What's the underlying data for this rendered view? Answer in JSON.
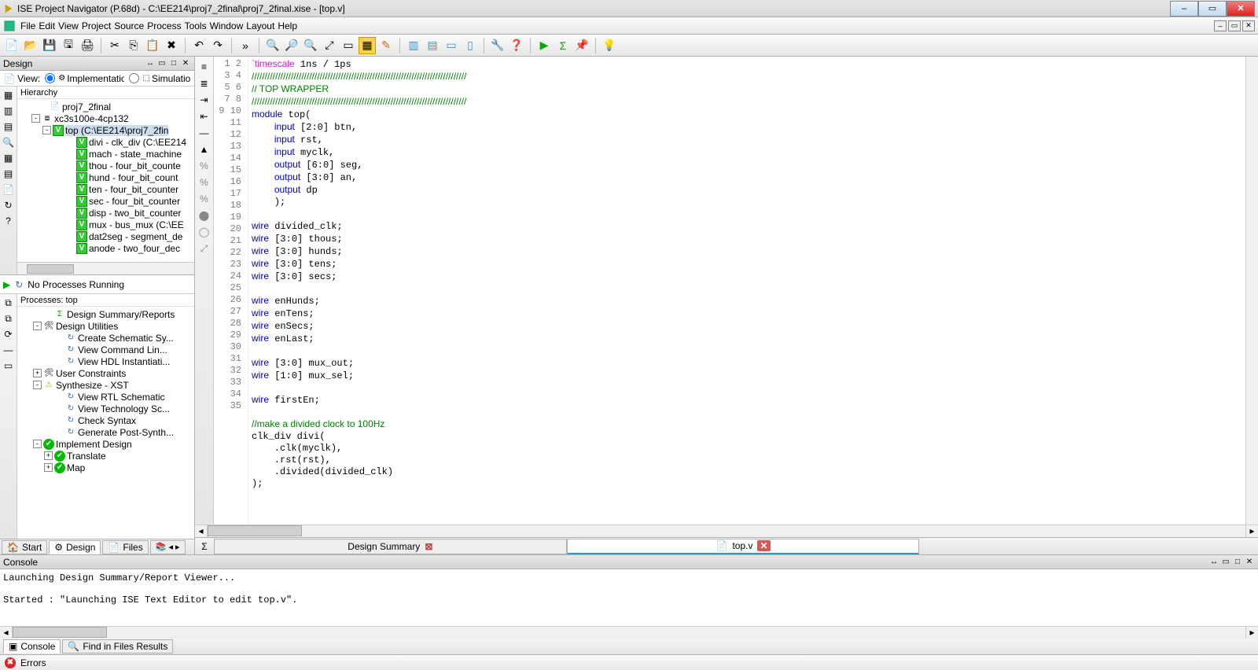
{
  "title": "ISE Project Navigator (P.68d) - C:\\EE214\\proj7_2final\\proj7_2final.xise - [top.v]",
  "menubar": [
    "File",
    "Edit",
    "View",
    "Project",
    "Source",
    "Process",
    "Tools",
    "Window",
    "Layout",
    "Help"
  ],
  "design_panel_title": "Design",
  "view_label": "View:",
  "view_impl": "Implementation",
  "view_sim": "Simulation",
  "hierarchy_title": "Hierarchy",
  "hierarchy": [
    {
      "indent": 28,
      "exp": "",
      "icon": "📄",
      "label": "proj7_2final"
    },
    {
      "indent": 18,
      "exp": "-",
      "icon": "⧈",
      "label": "xc3s100e-4cp132"
    },
    {
      "indent": 32,
      "exp": "-",
      "icon": "V",
      "label": "top (C:\\EE214\\proj7_2fin",
      "sel": true
    },
    {
      "indent": 62,
      "exp": "",
      "icon": "V",
      "label": "divi - clk_div (C:\\EE214"
    },
    {
      "indent": 62,
      "exp": "",
      "icon": "V",
      "label": "mach - state_machine"
    },
    {
      "indent": 62,
      "exp": "",
      "icon": "V",
      "label": "thou - four_bit_counte"
    },
    {
      "indent": 62,
      "exp": "",
      "icon": "V",
      "label": "hund - four_bit_count"
    },
    {
      "indent": 62,
      "exp": "",
      "icon": "V",
      "label": "ten - four_bit_counter"
    },
    {
      "indent": 62,
      "exp": "",
      "icon": "V",
      "label": "sec - four_bit_counter"
    },
    {
      "indent": 62,
      "exp": "",
      "icon": "V",
      "label": "disp - two_bit_counter"
    },
    {
      "indent": 62,
      "exp": "",
      "icon": "V",
      "label": "mux - bus_mux (C:\\EE"
    },
    {
      "indent": 62,
      "exp": "",
      "icon": "V",
      "label": "dat2seg - segment_de"
    },
    {
      "indent": 62,
      "exp": "",
      "icon": "V",
      "label": "anode - two_four_dec"
    }
  ],
  "no_processes": "No Processes Running",
  "processes_title": "Processes: top",
  "processes": [
    {
      "indent": 34,
      "exp": "",
      "icon": "Σ",
      "label": "Design Summary/Reports"
    },
    {
      "indent": 20,
      "exp": "-",
      "icon": "🛠",
      "label": "Design Utilities"
    },
    {
      "indent": 48,
      "exp": "",
      "icon": "↻",
      "label": "Create Schematic Sy..."
    },
    {
      "indent": 48,
      "exp": "",
      "icon": "↻",
      "label": "View Command Lin..."
    },
    {
      "indent": 48,
      "exp": "",
      "icon": "↻",
      "label": "View HDL Instantiati..."
    },
    {
      "indent": 20,
      "exp": "+",
      "icon": "🛠",
      "label": "User Constraints"
    },
    {
      "indent": 20,
      "exp": "-",
      "icon": "⚠",
      "label": "Synthesize - XST"
    },
    {
      "indent": 48,
      "exp": "",
      "icon": "↻",
      "label": "View RTL Schematic"
    },
    {
      "indent": 48,
      "exp": "",
      "icon": "↻",
      "label": "View Technology Sc..."
    },
    {
      "indent": 48,
      "exp": "",
      "icon": "↻",
      "label": "Check Syntax"
    },
    {
      "indent": 48,
      "exp": "",
      "icon": "↻",
      "label": "Generate Post-Synth..."
    },
    {
      "indent": 20,
      "exp": "-",
      "icon": "✔",
      "label": "Implement Design"
    },
    {
      "indent": 34,
      "exp": "+",
      "icon": "✔",
      "label": "Translate"
    },
    {
      "indent": 34,
      "exp": "+",
      "icon": "✔",
      "label": "Map"
    }
  ],
  "bottom_tabs": {
    "start": "Start",
    "design": "Design",
    "files": "Files"
  },
  "code_lines": [
    {
      "n": 1,
      "html": "<span class='mag'>`timescale</span> 1ns / 1ps"
    },
    {
      "n": 2,
      "html": "<span class='cm'>//////////////////////////////////////////////////////////////////////////////////</span>"
    },
    {
      "n": 3,
      "html": "<span class='cm'>// TOP WRAPPER</span>"
    },
    {
      "n": 4,
      "html": "<span class='cm'>//////////////////////////////////////////////////////////////////////////////////</span>"
    },
    {
      "n": 5,
      "html": "<span class='kw'>module</span> top("
    },
    {
      "n": 6,
      "html": "    <span class='kw'>input</span> [2:0] btn,"
    },
    {
      "n": 7,
      "html": "    <span class='kw'>input</span> rst,"
    },
    {
      "n": 8,
      "html": "    <span class='kw'>input</span> myclk,"
    },
    {
      "n": 9,
      "html": "    <span class='kw'>output</span> [6:0] seg,"
    },
    {
      "n": 10,
      "html": "    <span class='kw'>output</span> [3:0] an,"
    },
    {
      "n": 11,
      "html": "    <span class='kw'>output</span> dp"
    },
    {
      "n": 12,
      "html": "    );"
    },
    {
      "n": 13,
      "html": ""
    },
    {
      "n": 14,
      "html": "<span class='kw'>wire</span> divided_clk;"
    },
    {
      "n": 15,
      "html": "<span class='kw'>wire</span> [3:0] thous;"
    },
    {
      "n": 16,
      "html": "<span class='kw'>wire</span> [3:0] hunds;"
    },
    {
      "n": 17,
      "html": "<span class='kw'>wire</span> [3:0] tens;"
    },
    {
      "n": 18,
      "html": "<span class='kw'>wire</span> [3:0] secs;"
    },
    {
      "n": 19,
      "html": ""
    },
    {
      "n": 20,
      "html": "<span class='kw'>wire</span> enHunds;"
    },
    {
      "n": 21,
      "html": "<span class='kw'>wire</span> enTens;"
    },
    {
      "n": 22,
      "html": "<span class='kw'>wire</span> enSecs;"
    },
    {
      "n": 23,
      "html": "<span class='kw'>wire</span> enLast;"
    },
    {
      "n": 24,
      "html": ""
    },
    {
      "n": 25,
      "html": "<span class='kw'>wire</span> [3:0] mux_out;"
    },
    {
      "n": 26,
      "html": "<span class='kw'>wire</span> [1:0] mux_sel;"
    },
    {
      "n": 27,
      "html": ""
    },
    {
      "n": 28,
      "html": "<span class='kw'>wire</span> firstEn;"
    },
    {
      "n": 29,
      "html": ""
    },
    {
      "n": 30,
      "html": "<span class='cm'>//make a divided clock to 100Hz</span>"
    },
    {
      "n": 31,
      "html": "clk_div divi("
    },
    {
      "n": 32,
      "html": "    .clk(myclk),"
    },
    {
      "n": 33,
      "html": "    .rst(rst),"
    },
    {
      "n": 34,
      "html": "    .divided(divided_clk)"
    },
    {
      "n": 35,
      "html": ");"
    }
  ],
  "doc_tabs": {
    "summary": "Design Summary",
    "topv": "top.v"
  },
  "console_title": "Console",
  "console_text": "Launching Design Summary/Report Viewer...\n\nStarted : \"Launching ISE Text Editor to edit top.v\".\n",
  "console_tabs": {
    "console": "Console",
    "find": "Find in Files Results"
  },
  "errors": "Errors"
}
